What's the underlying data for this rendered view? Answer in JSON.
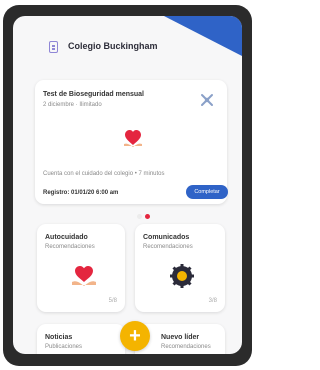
{
  "header": {
    "school_name": "Colegio Buckingham"
  },
  "main_card": {
    "title": "Test de Bioseguridad mensual",
    "subtitle": "2 diciembre · Ilimitado",
    "description": "Cuenta con el cuidado del colegio • 7 minutos",
    "registration": "Registro: 01/01/20 6:00 am",
    "action_label": "Completar"
  },
  "cards": [
    {
      "title": "Autocuidado",
      "subtitle": "Recomendaciones",
      "count": "5/8",
      "icon": "heart-hands-icon"
    },
    {
      "title": "Comunicados",
      "subtitle": "Recomendaciones",
      "count": "3/8",
      "icon": "gear-badge-icon"
    },
    {
      "title": "Noticias",
      "subtitle": "Publicaciones",
      "icon": "news-icon"
    },
    {
      "title": "Nuevo líder",
      "subtitle": "Recomendaciones",
      "icon": "leader-icon"
    }
  ],
  "colors": {
    "primary": "#2f63c7",
    "accent_red": "#e4263f",
    "fab": "#f4b400"
  }
}
